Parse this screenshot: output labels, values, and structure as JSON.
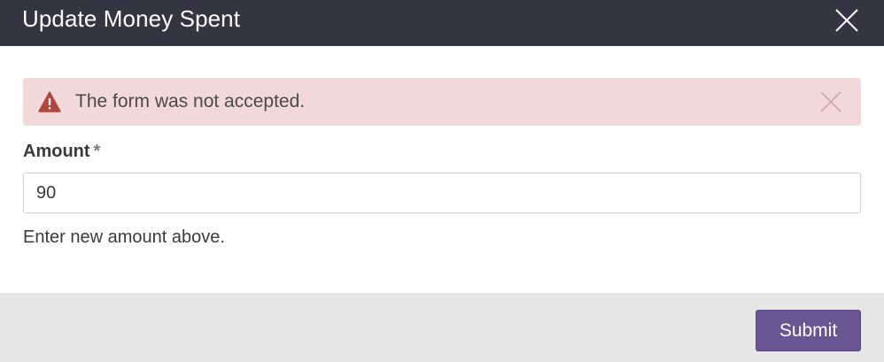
{
  "modal": {
    "title": "Update Money Spent",
    "close_icon": "close-icon"
  },
  "alert": {
    "message": "The form was not accepted.",
    "icon": "warning-icon",
    "close_icon": "close-icon",
    "colors": {
      "background": "#f2d8d9",
      "icon": "#b34740"
    }
  },
  "form": {
    "amount": {
      "label": "Amount",
      "required_mark": "*",
      "value": "90",
      "help_text": "Enter new amount above."
    }
  },
  "footer": {
    "submit_label": "Submit"
  },
  "colors": {
    "header": "#333542",
    "accent": "#6a5593",
    "footer": "#e6e6e6"
  }
}
